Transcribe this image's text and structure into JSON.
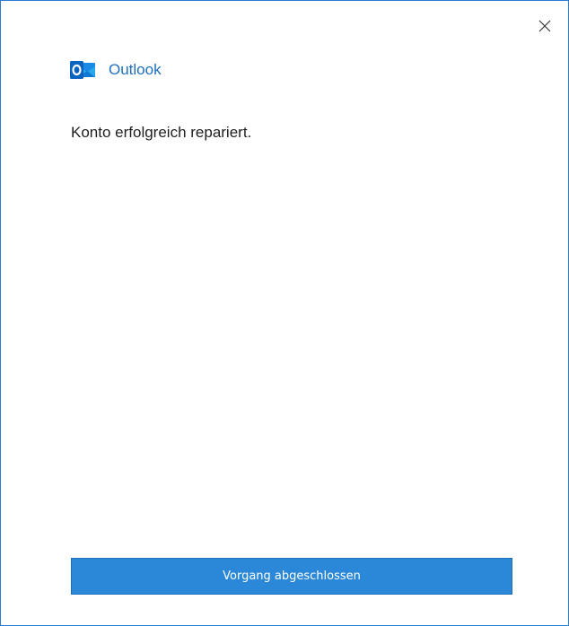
{
  "app": {
    "name": "Outlook",
    "logo_icon": "outlook-logo-icon",
    "accent_color": "#1e6fbf"
  },
  "dialog": {
    "close_icon": "close-icon",
    "message": "Konto erfolgreich repariert.",
    "done_button_label": "Vorgang abgeschlossen",
    "button_color": "#2b88d8"
  }
}
